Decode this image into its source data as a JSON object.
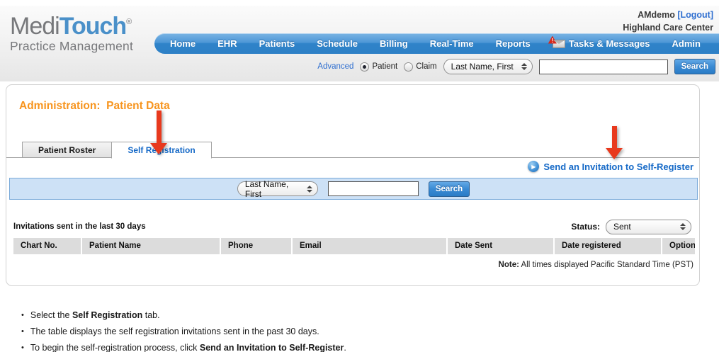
{
  "header": {
    "logo": {
      "part1": "Medi",
      "part2": "Touch",
      "reg": "®",
      "subtitle": "Practice Management"
    },
    "user": {
      "name": "AMdemo",
      "logout": "[Logout]",
      "org": "Highland Care Center"
    },
    "nav": {
      "items": [
        {
          "label": "Home"
        },
        {
          "label": "EHR"
        },
        {
          "label": "Patients"
        },
        {
          "label": "Schedule"
        },
        {
          "label": "Billing"
        },
        {
          "label": "Real-Time"
        },
        {
          "label": "Reports"
        },
        {
          "label": "Tasks & Messages",
          "icon": "envelope-alert-icon"
        },
        {
          "label": "Admin"
        }
      ]
    },
    "search": {
      "advanced_label": "Advanced",
      "radio_patient_label": "Patient",
      "radio_claim_label": "Claim",
      "select_value": "Last Name, First",
      "input_value": "",
      "button_label": "Search"
    }
  },
  "main": {
    "title": "Administration:  Patient Data",
    "tabs": [
      {
        "label": "Patient Roster",
        "active": false
      },
      {
        "label": "Self Registration",
        "active": true
      }
    ],
    "send_invite_link": "Send an Invitation to Self-Register",
    "filter_bar": {
      "select_value": "Last Name, First",
      "input_value": "",
      "button_label": "Search"
    },
    "list_caption": "Invitations sent in the last 30 days",
    "status": {
      "label": "Status:",
      "value": "Sent"
    },
    "table": {
      "columns": [
        "Chart No.",
        "Patient Name",
        "Phone",
        "Email",
        "Date Sent",
        "Date registered",
        "Options"
      ],
      "rows": []
    },
    "note": {
      "bold": "Note:",
      "text": " All times displayed Pacific Standard Time (PST)"
    }
  },
  "instructions": {
    "bullets": [
      {
        "pre": "Select the ",
        "bold": "Self Registration",
        "post": " tab."
      },
      {
        "pre": "The table displays the self registration invitations sent in the past 30 days.",
        "bold": "",
        "post": ""
      },
      {
        "pre": "To begin the self-registration process, click ",
        "bold": "Send an Invitation to Self-Register",
        "post": "."
      }
    ]
  }
}
